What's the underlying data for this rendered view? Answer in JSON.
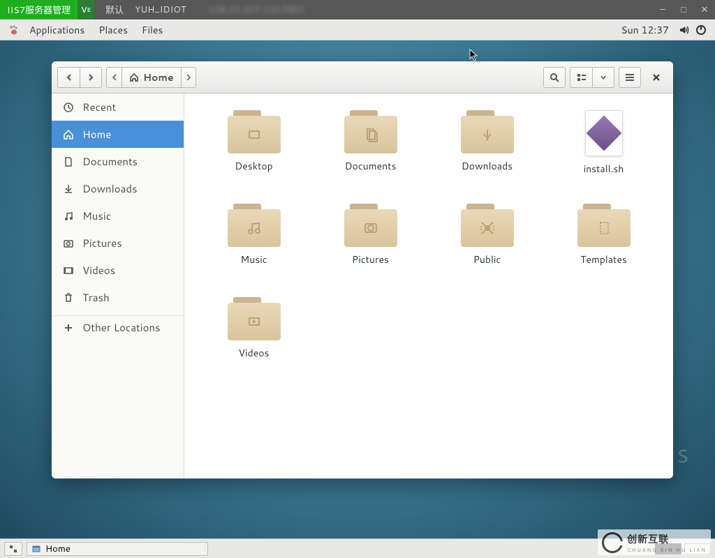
{
  "vnc": {
    "server_label": "IIS7服务器管理",
    "vnc_label": "V͟e",
    "default_label": "默认",
    "session_name": "YUH_IDIOT",
    "obscured": "128.23.107.120:5901"
  },
  "panel": {
    "applications": "Applications",
    "places": "Places",
    "files": "Files",
    "clock": "Sun 12:37"
  },
  "nautilus": {
    "path_label": "Home",
    "sidebar": [
      {
        "key": "recent",
        "label": "Recent"
      },
      {
        "key": "home",
        "label": "Home"
      },
      {
        "key": "documents",
        "label": "Documents"
      },
      {
        "key": "downloads",
        "label": "Downloads"
      },
      {
        "key": "music",
        "label": "Music"
      },
      {
        "key": "pictures",
        "label": "Pictures"
      },
      {
        "key": "videos",
        "label": "Videos"
      },
      {
        "key": "trash",
        "label": "Trash"
      },
      {
        "key": "other",
        "label": "Other Locations"
      }
    ],
    "files": [
      {
        "name": "Desktop",
        "type": "folder",
        "glyph": "desktop"
      },
      {
        "name": "Documents",
        "type": "folder",
        "glyph": "documents"
      },
      {
        "name": "Downloads",
        "type": "folder",
        "glyph": "downloads"
      },
      {
        "name": "install.sh",
        "type": "script"
      },
      {
        "name": "Music",
        "type": "folder",
        "glyph": "music"
      },
      {
        "name": "Pictures",
        "type": "folder",
        "glyph": "pictures"
      },
      {
        "name": "Public",
        "type": "folder",
        "glyph": "public"
      },
      {
        "name": "Templates",
        "type": "folder",
        "glyph": "templates"
      },
      {
        "name": "Videos",
        "type": "folder",
        "glyph": "videos"
      }
    ]
  },
  "taskbar": {
    "window_label": "Home"
  },
  "desktop": {
    "distro_mark": "T O S"
  },
  "watermark": {
    "text": "创新互联",
    "sub": "CHUANG XIN HU LIAN"
  }
}
